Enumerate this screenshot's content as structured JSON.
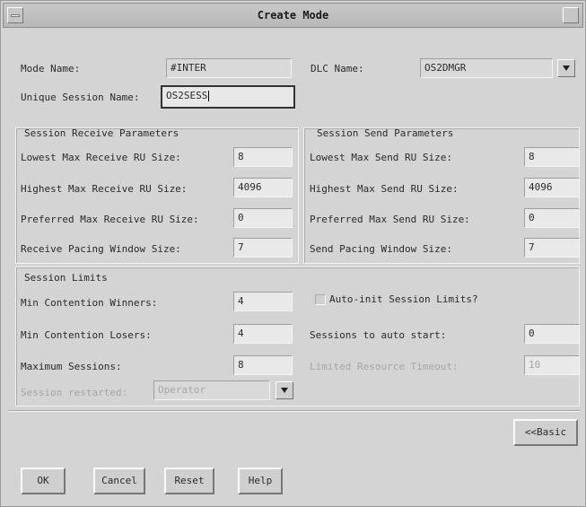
{
  "window": {
    "title": "Create Mode"
  },
  "mode": {
    "mode_name_label": "Mode Name:",
    "mode_name_value": "#INTER",
    "dlc_name_label": "DLC Name:",
    "dlc_name_value": "OS2DMGR",
    "unique_session_label": "Unique Session Name:",
    "unique_session_value": "OS2SESS"
  },
  "receive": {
    "heading": "Session Receive Parameters",
    "lowest_label": "Lowest Max Receive RU Size:",
    "lowest_value": "8",
    "highest_label": "Highest Max Receive RU Size:",
    "highest_value": "4096",
    "preferred_label": "Preferred Max Receive RU Size:",
    "preferred_value": "0",
    "pacing_label": "Receive Pacing Window Size:",
    "pacing_value": "7"
  },
  "send": {
    "heading": "Session Send Parameters",
    "lowest_label": "Lowest Max Send RU Size:",
    "lowest_value": "8",
    "highest_label": "Highest Max Send RU Size:",
    "highest_value": "4096",
    "preferred_label": "Preferred Max Send RU Size:",
    "preferred_value": "0",
    "pacing_label": "Send Pacing Window Size:",
    "pacing_value": "7"
  },
  "limits": {
    "heading": "Session Limits",
    "min_winners_label": "Min Contention Winners:",
    "min_winners_value": "4",
    "min_losers_label": "Min Contention Losers:",
    "min_losers_value": "4",
    "max_sessions_label": "Maximum Sessions:",
    "max_sessions_value": "8",
    "auto_init_label": "Auto-init Session Limits?",
    "auto_start_label": "Sessions to auto start:",
    "auto_start_value": "0",
    "limited_timeout_label": "Limited Resource Timeout:",
    "limited_timeout_value": "10",
    "restarted_label": "Session restarted:",
    "restarted_value": "Operator"
  },
  "buttons": {
    "basic": "<<Basic",
    "ok": "OK",
    "cancel": "Cancel",
    "reset": "Reset",
    "help": "Help"
  },
  "icons": {
    "window_menu": "window-menu-icon",
    "maximize": "maximize-icon",
    "dropdown": "dropdown-arrow-icon",
    "checkbox": "checkbox-icon"
  }
}
